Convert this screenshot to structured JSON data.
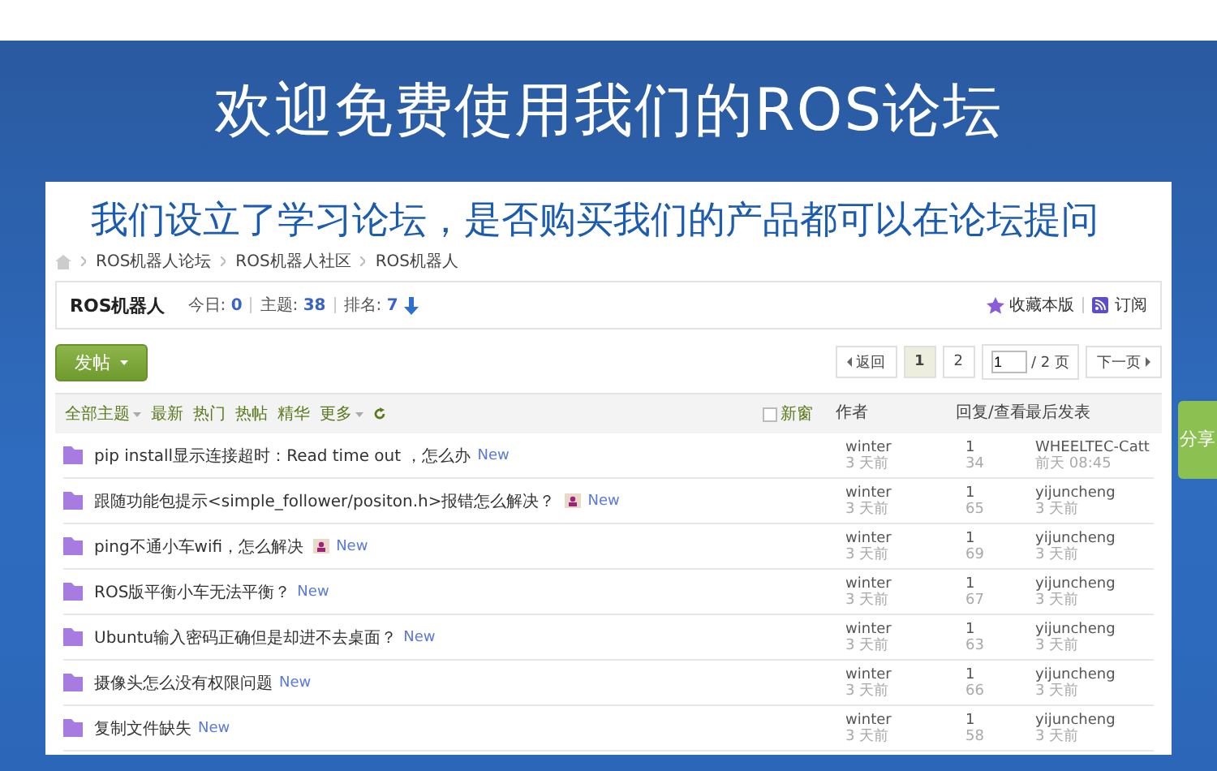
{
  "banner": {
    "title": "欢迎免费使用我们的ROS论坛",
    "subtitle": "我们设立了学习论坛，是否购买我们的产品都可以在论坛提问"
  },
  "breadcrumb": [
    "ROS机器人论坛",
    "ROS机器人社区",
    "ROS机器人"
  ],
  "forum": {
    "name": "ROS机器人",
    "stats": [
      {
        "label": "今日:",
        "value": "0"
      },
      {
        "label": "主题:",
        "value": "38"
      },
      {
        "label": "排名:",
        "value": "7"
      }
    ],
    "actions": [
      {
        "kind": "star",
        "label": "收藏本版"
      },
      {
        "kind": "rss",
        "label": "订阅"
      }
    ]
  },
  "post_button": "发帖",
  "pagination": {
    "back": "返回",
    "pages": [
      {
        "label": "1",
        "selected": true
      },
      {
        "label": "2",
        "selected": false
      }
    ],
    "page_input": "1",
    "total": "/ 2 页",
    "next": "下一页"
  },
  "filters": [
    {
      "label": "全部主题",
      "dropdown": true
    },
    {
      "label": "最新",
      "dropdown": false
    },
    {
      "label": "热门",
      "dropdown": false
    },
    {
      "label": "热帖",
      "dropdown": false
    },
    {
      "label": "精华",
      "dropdown": false
    },
    {
      "label": "更多",
      "dropdown": true
    }
  ],
  "new_window": {
    "label": "新窗",
    "checked": false
  },
  "columns": [
    "作者",
    "回复/查看",
    "最后发表"
  ],
  "threads": [
    {
      "title": "pip install显示连接超时：Read time out ，怎么办",
      "has_image": false,
      "badge": "New",
      "author": "winter",
      "author_time": "3 天前",
      "replies": "1",
      "views": "34",
      "last_user": "WHEELTEC-Catt",
      "last_time": "前天 08:45"
    },
    {
      "title": "跟随功能包提示<simple_follower/positon.h>报错怎么解决？",
      "has_image": true,
      "badge": "New",
      "author": "winter",
      "author_time": "3 天前",
      "replies": "1",
      "views": "65",
      "last_user": "yijuncheng",
      "last_time": "3 天前"
    },
    {
      "title": "ping不通小车wifi，怎么解决",
      "has_image": true,
      "badge": "New",
      "author": "winter",
      "author_time": "3 天前",
      "replies": "1",
      "views": "69",
      "last_user": "yijuncheng",
      "last_time": "3 天前"
    },
    {
      "title": "ROS版平衡小车无法平衡？",
      "has_image": false,
      "badge": "New",
      "author": "winter",
      "author_time": "3 天前",
      "replies": "1",
      "views": "67",
      "last_user": "yijuncheng",
      "last_time": "3 天前"
    },
    {
      "title": "Ubuntu输入密码正确但是却进不去桌面？",
      "has_image": false,
      "badge": "New",
      "author": "winter",
      "author_time": "3 天前",
      "replies": "1",
      "views": "63",
      "last_user": "yijuncheng",
      "last_time": "3 天前"
    },
    {
      "title": "摄像头怎么没有权限问题",
      "has_image": false,
      "badge": "New",
      "author": "winter",
      "author_time": "3 天前",
      "replies": "1",
      "views": "66",
      "last_user": "yijuncheng",
      "last_time": "3 天前"
    },
    {
      "title": "复制文件缺失",
      "has_image": false,
      "badge": "New",
      "author": "winter",
      "author_time": "3 天前",
      "replies": "1",
      "views": "58",
      "last_user": "yijuncheng",
      "last_time": "3 天前"
    }
  ],
  "share_tab": "分享"
}
